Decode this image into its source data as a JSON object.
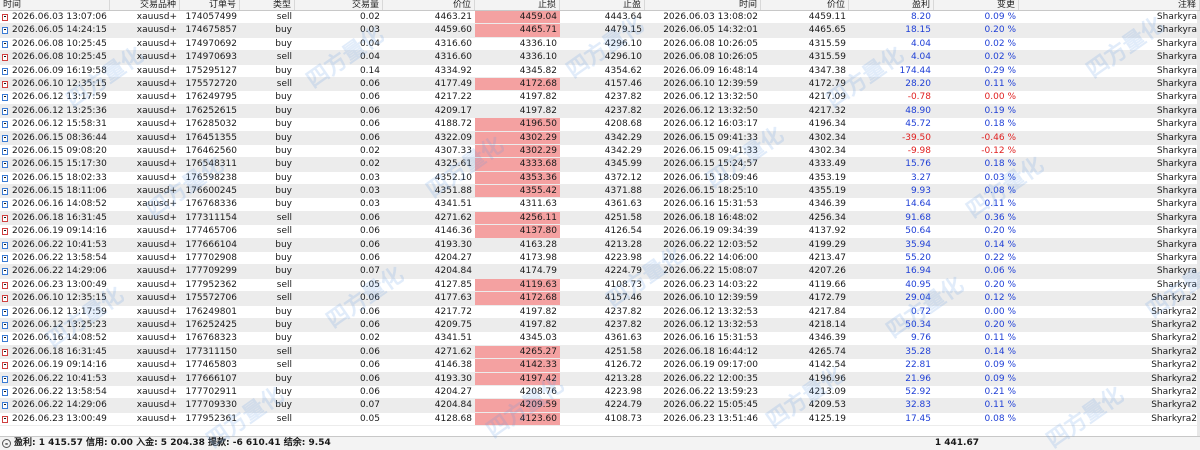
{
  "columns": [
    "时间",
    "交易品种",
    "订单号",
    "类型",
    "交易量",
    "价位",
    "止损",
    "止盈",
    "时间",
    "价位",
    "盈利",
    "变更",
    "注释"
  ],
  "rows": [
    {
      "type": "sell",
      "open_time": "2026.06.03 13:07:06",
      "symbol": "xauusd+",
      "order": "174057499",
      "volume": "0.02",
      "open_price": "4463.21",
      "sl": "4459.04",
      "tp": "4443.64",
      "close_time": "2026.06.03 13:08:02",
      "close_price": "4459.11",
      "profit": "8.20",
      "change": "0.09 %",
      "comment": "Sharkyra",
      "sl_hit": true,
      "sign": "pos"
    },
    {
      "type": "buy",
      "open_time": "2026.06.05 14:24:15",
      "symbol": "xauusd+",
      "order": "174675857",
      "volume": "0.03",
      "open_price": "4459.60",
      "sl": "4465.71",
      "tp": "4479.15",
      "close_time": "2026.06.05 14:32:01",
      "close_price": "4465.65",
      "profit": "18.15",
      "change": "0.20 %",
      "comment": "Sharkyra",
      "sl_hit": true,
      "sign": "pos"
    },
    {
      "type": "buy",
      "open_time": "2026.06.08 10:25:45",
      "symbol": "xauusd+",
      "order": "174970692",
      "volume": "0.04",
      "open_price": "4316.60",
      "sl": "4336.10",
      "tp": "4296.10",
      "close_time": "2026.06.08 10:26:05",
      "close_price": "4315.59",
      "profit": "4.04",
      "change": "0.02 %",
      "comment": "Sharkyra",
      "sl_hit": false,
      "sign": "pos"
    },
    {
      "type": "sell",
      "open_time": "2026.06.08 10:25:45",
      "symbol": "xauusd+",
      "order": "174970693",
      "volume": "0.04",
      "open_price": "4316.60",
      "sl": "4336.10",
      "tp": "4296.10",
      "close_time": "2026.06.08 10:26:05",
      "close_price": "4315.59",
      "profit": "4.04",
      "change": "0.02 %",
      "comment": "Sharkyra",
      "sl_hit": false,
      "sign": "pos"
    },
    {
      "type": "buy",
      "open_time": "2026.06.09 16:19:58",
      "symbol": "xauusd+",
      "order": "175295127",
      "volume": "0.14",
      "open_price": "4334.92",
      "sl": "4345.82",
      "tp": "4354.62",
      "close_time": "2026.06.09 16:48:14",
      "close_price": "4347.38",
      "profit": "174.44",
      "change": "0.29 %",
      "comment": "Sharkyra",
      "sl_hit": false,
      "sign": "pos"
    },
    {
      "type": "sell",
      "open_time": "2026.06.10 12:35:15",
      "symbol": "xauusd+",
      "order": "175572720",
      "volume": "0.06",
      "open_price": "4177.49",
      "sl": "4172.68",
      "tp": "4157.46",
      "close_time": "2026.06.10 12:39:59",
      "close_price": "4172.79",
      "profit": "28.20",
      "change": "0.11 %",
      "comment": "Sharkyra",
      "sl_hit": true,
      "sign": "pos"
    },
    {
      "type": "buy",
      "open_time": "2026.06.12 13:17:59",
      "symbol": "xauusd+",
      "order": "176249795",
      "volume": "0.06",
      "open_price": "4217.22",
      "sl": "4197.82",
      "tp": "4237.82",
      "close_time": "2026.06.12 13:32:50",
      "close_price": "4217.09",
      "profit": "-0.78",
      "change": "0.00 %",
      "comment": "Sharkyra",
      "sl_hit": false,
      "sign": "neg"
    },
    {
      "type": "buy",
      "open_time": "2026.06.12 13:25:36",
      "symbol": "xauusd+",
      "order": "176252615",
      "volume": "0.06",
      "open_price": "4209.17",
      "sl": "4197.82",
      "tp": "4237.82",
      "close_time": "2026.06.12 13:32:50",
      "close_price": "4217.32",
      "profit": "48.90",
      "change": "0.19 %",
      "comment": "Sharkyra",
      "sl_hit": false,
      "sign": "pos"
    },
    {
      "type": "buy",
      "open_time": "2026.06.12 15:58:31",
      "symbol": "xauusd+",
      "order": "176285032",
      "volume": "0.06",
      "open_price": "4188.72",
      "sl": "4196.50",
      "tp": "4208.68",
      "close_time": "2026.06.12 16:03:17",
      "close_price": "4196.34",
      "profit": "45.72",
      "change": "0.18 %",
      "comment": "Sharkyra",
      "sl_hit": true,
      "sign": "pos"
    },
    {
      "type": "buy",
      "open_time": "2026.06.15 08:36:44",
      "symbol": "xauusd+",
      "order": "176451355",
      "volume": "0.06",
      "open_price": "4322.09",
      "sl": "4302.29",
      "tp": "4342.29",
      "close_time": "2026.06.15 09:41:33",
      "close_price": "4302.34",
      "profit": "-39.50",
      "change": "-0.46 %",
      "comment": "Sharkyra",
      "sl_hit": true,
      "sign": "neg"
    },
    {
      "type": "buy",
      "open_time": "2026.06.15 09:08:20",
      "symbol": "xauusd+",
      "order": "176462560",
      "volume": "0.02",
      "open_price": "4307.33",
      "sl": "4302.29",
      "tp": "4342.29",
      "close_time": "2026.06.15 09:41:33",
      "close_price": "4302.34",
      "profit": "-9.98",
      "change": "-0.12 %",
      "comment": "Sharkyra",
      "sl_hit": true,
      "sign": "neg"
    },
    {
      "type": "buy",
      "open_time": "2026.06.15 15:17:30",
      "symbol": "xauusd+",
      "order": "176548311",
      "volume": "0.02",
      "open_price": "4325.61",
      "sl": "4333.68",
      "tp": "4345.99",
      "close_time": "2026.06.15 15:24:57",
      "close_price": "4333.49",
      "profit": "15.76",
      "change": "0.18 %",
      "comment": "Sharkyra",
      "sl_hit": true,
      "sign": "pos"
    },
    {
      "type": "buy",
      "open_time": "2026.06.15 18:02:33",
      "symbol": "xauusd+",
      "order": "176598238",
      "volume": "0.03",
      "open_price": "4352.10",
      "sl": "4353.36",
      "tp": "4372.12",
      "close_time": "2026.06.15 18:09:46",
      "close_price": "4353.19",
      "profit": "3.27",
      "change": "0.03 %",
      "comment": "Sharkyra",
      "sl_hit": true,
      "sign": "pos"
    },
    {
      "type": "buy",
      "open_time": "2026.06.15 18:11:06",
      "symbol": "xauusd+",
      "order": "176600245",
      "volume": "0.03",
      "open_price": "4351.88",
      "sl": "4355.42",
      "tp": "4371.88",
      "close_time": "2026.06.15 18:25:10",
      "close_price": "4355.19",
      "profit": "9.93",
      "change": "0.08 %",
      "comment": "Sharkyra",
      "sl_hit": true,
      "sign": "pos"
    },
    {
      "type": "buy",
      "open_time": "2026.06.16 14:08:52",
      "symbol": "xauusd+",
      "order": "176768336",
      "volume": "0.03",
      "open_price": "4341.51",
      "sl": "4311.63",
      "tp": "4361.63",
      "close_time": "2026.06.16 15:31:53",
      "close_price": "4346.39",
      "profit": "14.64",
      "change": "0.11 %",
      "comment": "Sharkyra",
      "sl_hit": false,
      "sign": "pos"
    },
    {
      "type": "sell",
      "open_time": "2026.06.18 16:31:45",
      "symbol": "xauusd+",
      "order": "177311154",
      "volume": "0.06",
      "open_price": "4271.62",
      "sl": "4256.11",
      "tp": "4251.58",
      "close_time": "2026.06.18 16:48:02",
      "close_price": "4256.34",
      "profit": "91.68",
      "change": "0.36 %",
      "comment": "Sharkyra",
      "sl_hit": true,
      "sign": "pos"
    },
    {
      "type": "sell",
      "open_time": "2026.06.19 09:14:16",
      "symbol": "xauusd+",
      "order": "177465706",
      "volume": "0.06",
      "open_price": "4146.36",
      "sl": "4137.80",
      "tp": "4126.54",
      "close_time": "2026.06.19 09:34:39",
      "close_price": "4137.92",
      "profit": "50.64",
      "change": "0.20 %",
      "comment": "Sharkyra",
      "sl_hit": true,
      "sign": "pos"
    },
    {
      "type": "buy",
      "open_time": "2026.06.22 10:41:53",
      "symbol": "xauusd+",
      "order": "177666104",
      "volume": "0.06",
      "open_price": "4193.30",
      "sl": "4163.28",
      "tp": "4213.28",
      "close_time": "2026.06.22 12:03:52",
      "close_price": "4199.29",
      "profit": "35.94",
      "change": "0.14 %",
      "comment": "Sharkyra",
      "sl_hit": false,
      "sign": "pos"
    },
    {
      "type": "buy",
      "open_time": "2026.06.22 13:58:54",
      "symbol": "xauusd+",
      "order": "177702908",
      "volume": "0.06",
      "open_price": "4204.27",
      "sl": "4173.98",
      "tp": "4223.98",
      "close_time": "2026.06.22 14:06:00",
      "close_price": "4213.47",
      "profit": "55.20",
      "change": "0.22 %",
      "comment": "Sharkyra",
      "sl_hit": false,
      "sign": "pos"
    },
    {
      "type": "buy",
      "open_time": "2026.06.22 14:29:06",
      "symbol": "xauusd+",
      "order": "177709299",
      "volume": "0.07",
      "open_price": "4204.84",
      "sl": "4174.79",
      "tp": "4224.79",
      "close_time": "2026.06.22 15:08:07",
      "close_price": "4207.26",
      "profit": "16.94",
      "change": "0.06 %",
      "comment": "Sharkyra",
      "sl_hit": false,
      "sign": "pos"
    },
    {
      "type": "sell",
      "open_time": "2026.06.23 13:00:49",
      "symbol": "xauusd+",
      "order": "177952362",
      "volume": "0.05",
      "open_price": "4127.85",
      "sl": "4119.63",
      "tp": "4108.73",
      "close_time": "2026.06.23 14:03:22",
      "close_price": "4119.66",
      "profit": "40.95",
      "change": "0.20 %",
      "comment": "Sharkyra",
      "sl_hit": true,
      "sign": "pos"
    },
    {
      "type": "sell",
      "open_time": "2026.06.10 12:35:15",
      "symbol": "xauusd+",
      "order": "175572706",
      "volume": "0.06",
      "open_price": "4177.63",
      "sl": "4172.68",
      "tp": "4157.46",
      "close_time": "2026.06.10 12:39:59",
      "close_price": "4172.79",
      "profit": "29.04",
      "change": "0.12 %",
      "comment": "Sharkyra2",
      "sl_hit": true,
      "sign": "pos"
    },
    {
      "type": "buy",
      "open_time": "2026.06.12 13:17:59",
      "symbol": "xauusd+",
      "order": "176249801",
      "volume": "0.06",
      "open_price": "4217.72",
      "sl": "4197.82",
      "tp": "4237.82",
      "close_time": "2026.06.12 13:32:53",
      "close_price": "4217.84",
      "profit": "0.72",
      "change": "0.00 %",
      "comment": "Sharkyra2",
      "sl_hit": false,
      "sign": "pos"
    },
    {
      "type": "buy",
      "open_time": "2026.06.12 13:25:23",
      "symbol": "xauusd+",
      "order": "176252425",
      "volume": "0.06",
      "open_price": "4209.75",
      "sl": "4197.82",
      "tp": "4237.82",
      "close_time": "2026.06.12 13:32:53",
      "close_price": "4218.14",
      "profit": "50.34",
      "change": "0.20 %",
      "comment": "Sharkyra2",
      "sl_hit": false,
      "sign": "pos"
    },
    {
      "type": "buy",
      "open_time": "2026.06.16 14:08:52",
      "symbol": "xauusd+",
      "order": "176768323",
      "volume": "0.02",
      "open_price": "4341.51",
      "sl": "4345.03",
      "tp": "4361.63",
      "close_time": "2026.06.16 15:31:53",
      "close_price": "4346.39",
      "profit": "9.76",
      "change": "0.11 %",
      "comment": "Sharkyra2",
      "sl_hit": false,
      "sign": "pos"
    },
    {
      "type": "sell",
      "open_time": "2026.06.18 16:31:45",
      "symbol": "xauusd+",
      "order": "177311150",
      "volume": "0.06",
      "open_price": "4271.62",
      "sl": "4265.27",
      "tp": "4251.58",
      "close_time": "2026.06.18 16:44:12",
      "close_price": "4265.74",
      "profit": "35.28",
      "change": "0.14 %",
      "comment": "Sharkyra2",
      "sl_hit": true,
      "sign": "pos"
    },
    {
      "type": "sell",
      "open_time": "2026.06.19 09:14:16",
      "symbol": "xauusd+",
      "order": "177465803",
      "volume": "0.06",
      "open_price": "4146.38",
      "sl": "4142.33",
      "tp": "4126.72",
      "close_time": "2026.06.19 09:17:00",
      "close_price": "4142.54",
      "profit": "22.81",
      "change": "0.09 %",
      "comment": "Sharkyra2",
      "sl_hit": true,
      "sign": "pos"
    },
    {
      "type": "buy",
      "open_time": "2026.06.22 10:41:53",
      "symbol": "xauusd+",
      "order": "177666107",
      "volume": "0.06",
      "open_price": "4193.30",
      "sl": "4197.42",
      "tp": "4213.28",
      "close_time": "2026.06.22 12:00:35",
      "close_price": "4196.96",
      "profit": "21.96",
      "change": "0.09 %",
      "comment": "Sharkyra2",
      "sl_hit": true,
      "sign": "pos"
    },
    {
      "type": "buy",
      "open_time": "2026.06.22 13:58:54",
      "symbol": "xauusd+",
      "order": "177702911",
      "volume": "0.06",
      "open_price": "4204.27",
      "sl": "4208.76",
      "tp": "4223.98",
      "close_time": "2026.06.22 13:59:23",
      "close_price": "4213.09",
      "profit": "52.92",
      "change": "0.21 %",
      "comment": "Sharkyra2",
      "sl_hit": false,
      "sign": "pos"
    },
    {
      "type": "buy",
      "open_time": "2026.06.22 14:29:06",
      "symbol": "xauusd+",
      "order": "177709330",
      "volume": "0.07",
      "open_price": "4204.84",
      "sl": "4209.59",
      "tp": "4224.79",
      "close_time": "2026.06.22 15:05:45",
      "close_price": "4209.53",
      "profit": "32.83",
      "change": "0.11 %",
      "comment": "Sharkyra2",
      "sl_hit": true,
      "sign": "pos"
    },
    {
      "type": "sell",
      "open_time": "2026.06.23 13:00:49",
      "symbol": "xauusd+",
      "order": "177952361",
      "volume": "0.05",
      "open_price": "4128.68",
      "sl": "4123.60",
      "tp": "4108.73",
      "close_time": "2026.06.23 13:51:46",
      "close_price": "4125.19",
      "profit": "17.45",
      "change": "0.08 %",
      "comment": "Sharkyra2",
      "sl_hit": true,
      "sign": "pos"
    }
  ],
  "footer": {
    "summary": "盈利: 1 415.57  信用: 0.00  入金: 5 204.38  提款: -6 610.41  结余: 9.54",
    "total_profit": "1 441.67"
  },
  "colors": {
    "positive": "#1f3fd6",
    "negative": "#e02020",
    "sl_highlight": "#f4a1a1"
  },
  "icons": {
    "buy_row": "buy-order-icon",
    "sell_row": "sell-order-icon",
    "footer": "balance-circle-icon"
  }
}
